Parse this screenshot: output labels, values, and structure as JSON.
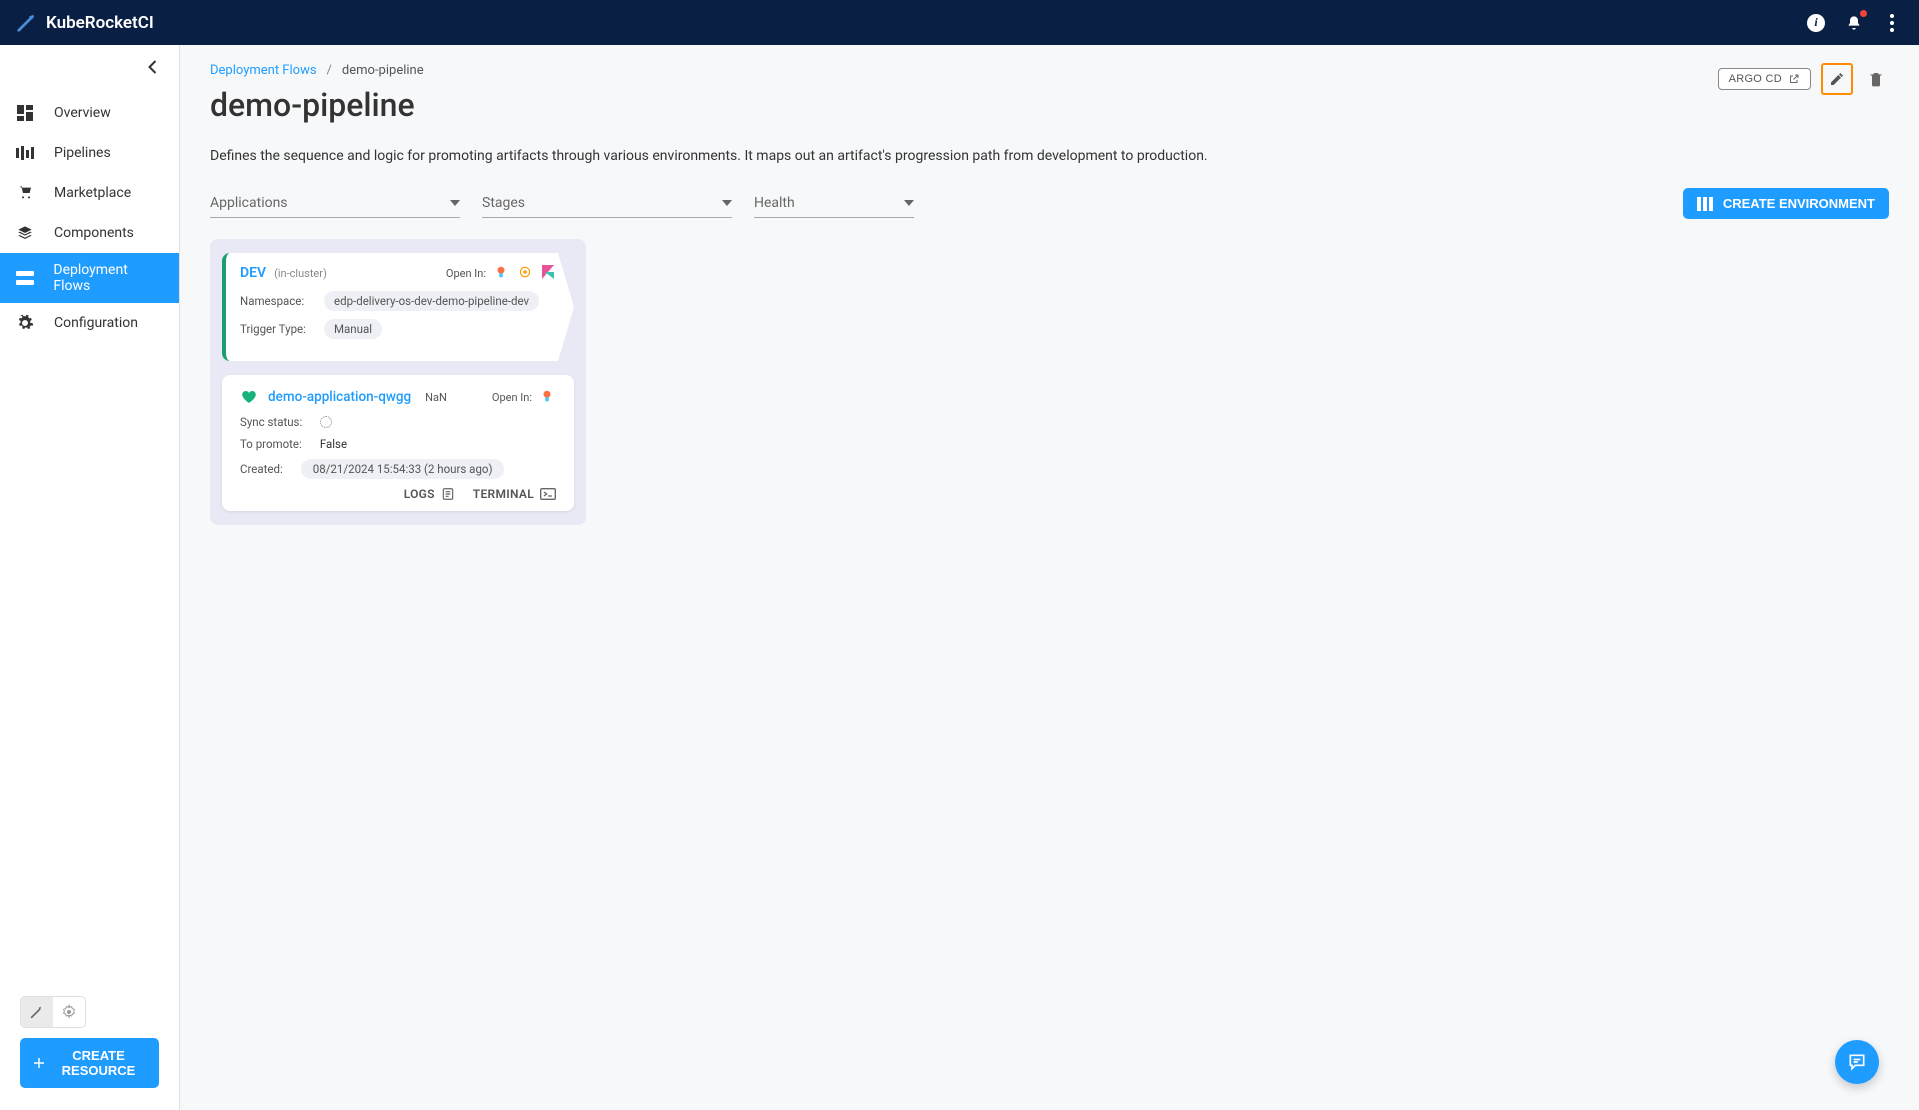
{
  "header": {
    "brand": "KubeRocketCI"
  },
  "sidebar": {
    "items": [
      {
        "label": "Overview"
      },
      {
        "label": "Pipelines"
      },
      {
        "label": "Marketplace"
      },
      {
        "label": "Components"
      },
      {
        "label": "Deployment Flows"
      },
      {
        "label": "Configuration"
      }
    ],
    "create_resource": "CREATE RESOURCE"
  },
  "breadcrumb": {
    "parent": "Deployment Flows",
    "current": "demo-pipeline"
  },
  "page": {
    "title": "demo-pipeline",
    "description": "Defines the sequence and logic for promoting artifacts through various environments. It maps out an artifact's progression path from development to production."
  },
  "header_actions": {
    "argo_cd": "ARGO CD"
  },
  "filters": {
    "applications": "Applications",
    "stages": "Stages",
    "health": "Health"
  },
  "create_env_btn": "CREATE ENVIRONMENT",
  "stage": {
    "name": "DEV",
    "cluster": "(in-cluster)",
    "open_in": "Open In:",
    "namespace_label": "Namespace:",
    "namespace": "edp-delivery-os-dev-demo-pipeline-dev",
    "trigger_label": "Trigger Type:",
    "trigger": "Manual"
  },
  "app": {
    "name": "demo-application-qwgg",
    "nan": "NaN",
    "open_in": "Open In:",
    "sync_label": "Sync status:",
    "promote_label": "To promote:",
    "promote": "False",
    "created_label": "Created:",
    "created": "08/21/2024 15:54:33 (2 hours ago)",
    "logs": "LOGS",
    "terminal": "TERMINAL"
  }
}
